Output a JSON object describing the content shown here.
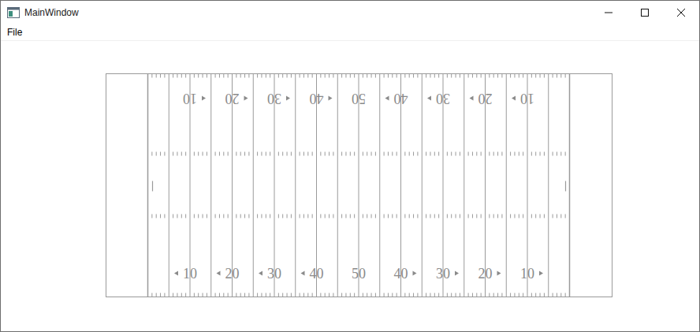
{
  "window": {
    "title": "MainWindow"
  },
  "menu": [
    {
      "label": "File"
    }
  ],
  "field": {
    "rows": [
      {
        "flipped": true,
        "numbers": [
          {
            "label": "10",
            "arrow": "left"
          },
          {
            "label": "20",
            "arrow": "left"
          },
          {
            "label": "30",
            "arrow": "left"
          },
          {
            "label": "40",
            "arrow": "left"
          },
          {
            "label": "50",
            "arrow": "none"
          },
          {
            "label": "40",
            "arrow": "right"
          },
          {
            "label": "30",
            "arrow": "right"
          },
          {
            "label": "20",
            "arrow": "right"
          },
          {
            "label": "10",
            "arrow": "right"
          }
        ]
      },
      {
        "flipped": false,
        "numbers": [
          {
            "label": "10",
            "arrow": "left"
          },
          {
            "label": "20",
            "arrow": "left"
          },
          {
            "label": "30",
            "arrow": "left"
          },
          {
            "label": "40",
            "arrow": "left"
          },
          {
            "label": "50",
            "arrow": "none"
          },
          {
            "label": "40",
            "arrow": "right"
          },
          {
            "label": "30",
            "arrow": "right"
          },
          {
            "label": "20",
            "arrow": "right"
          },
          {
            "label": "10",
            "arrow": "right"
          }
        ]
      }
    ]
  }
}
